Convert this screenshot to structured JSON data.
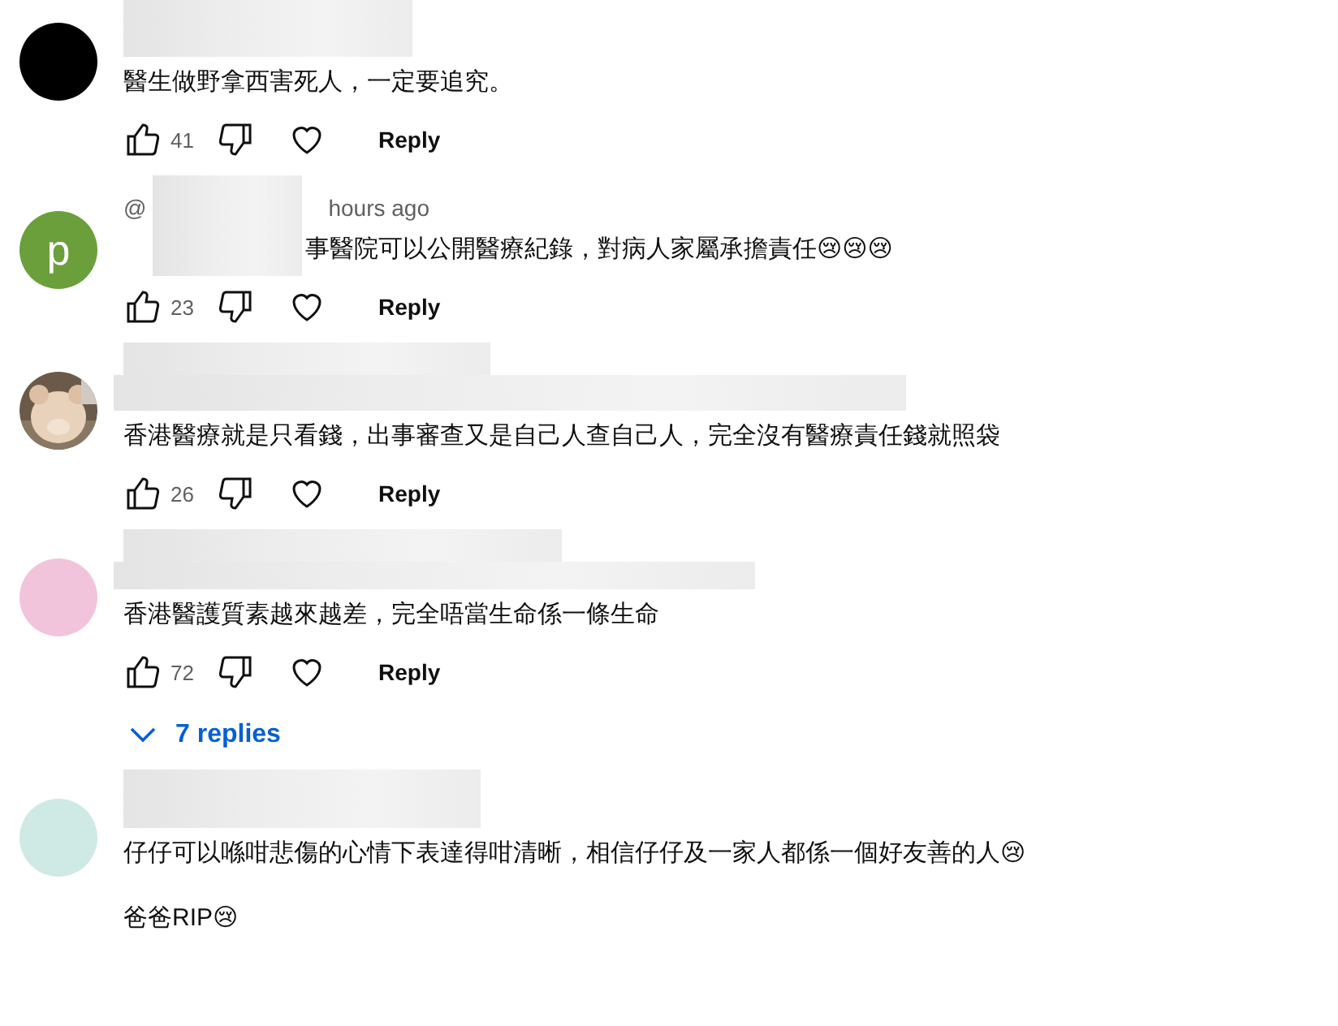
{
  "comments": [
    {
      "avatar": {
        "kind": "plain",
        "color": "#000000"
      },
      "paragraphs": [
        "醫生做野拿西害死人，一定要追究。"
      ],
      "likes": "41",
      "reply": "Reply"
    },
    {
      "avatar": {
        "kind": "letter",
        "color": "#6a9f3c",
        "letter": "p"
      },
      "author": "@",
      "time": "hours ago",
      "paragraphs": [
        "事醫院可以公開醫療紀錄，對病人家屬承擔責任😢😢😢"
      ],
      "likes": "23",
      "reply": "Reply"
    },
    {
      "avatar": {
        "kind": "picture"
      },
      "paragraphs": [
        "香港醫療就是只看錢，出事審查又是自己人查自己人，完全沒有醫療責任錢就照袋"
      ],
      "likes": "26",
      "reply": "Reply"
    },
    {
      "avatar": {
        "kind": "plain",
        "color": "#f2c4dc"
      },
      "paragraphs": [
        "香港醫護質素越來越差，完全唔當生命係一條生命"
      ],
      "likes": "72",
      "reply": "Reply",
      "replies_toggle": "7 replies"
    },
    {
      "avatar": {
        "kind": "plain",
        "color": "#cfe9e4"
      },
      "paragraphs": [
        "仔仔可以喺咁悲傷的心情下表達得咁清晰，相信仔仔及一家人都係一個好友善的人😢",
        "爸爸RIP😢"
      ]
    }
  ]
}
